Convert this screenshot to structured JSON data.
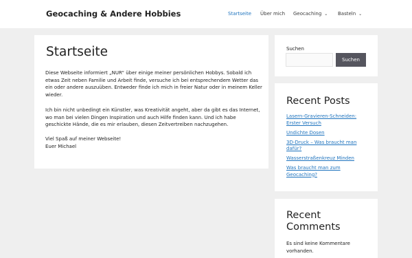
{
  "header": {
    "site_title": "Geocaching & Andere Hobbies",
    "nav": [
      "Startseite",
      "Über mich",
      "Geocaching",
      "Basteln"
    ]
  },
  "main": {
    "title": "Startseite",
    "p1": "Diese Webseite informiert „NUR“ über einige meiner persönlichen Hobbys. Sobald ich etwas Zeit neben Familie und Arbeit finde, versuche ich bei entsprechendem Wetter das ein oder andere auszuüben. Entweder finde ich mich in freier Natur oder in meinem Keller wieder.",
    "p2": "Ich bin nicht unbedingt ein Künstler, was Kreativität angeht, aber da gibt es das Internet, wo man bei vielen Dingen Inspiration und auch Hilfe finden kann. Und ich habe geschickte Hände, die es mir erlauben, diesen Zeitvertreiben nachzugehen.",
    "p3_line1": "Viel Spaß auf meiner Webseite!",
    "p3_line2": "Euer Michael"
  },
  "sidebar": {
    "search": {
      "label": "Suchen",
      "button": "Suchen",
      "value": ""
    },
    "recent_posts": {
      "title": "Recent Posts",
      "items": [
        "Lasern-Gravieren-Schneiden: Erster Versuch",
        "Undichte Dosen",
        "3D-Druck – Was braucht man dafür?",
        "Wasserstraßenkreuz Minden",
        "Was braucht man zum Geocaching?"
      ]
    },
    "recent_comments": {
      "title": "Recent Comments",
      "empty": "Es sind keine Kommentare vorhanden."
    }
  },
  "colors": {
    "accent": "#1e73be",
    "button": "#55555e",
    "background": "#efefef"
  }
}
